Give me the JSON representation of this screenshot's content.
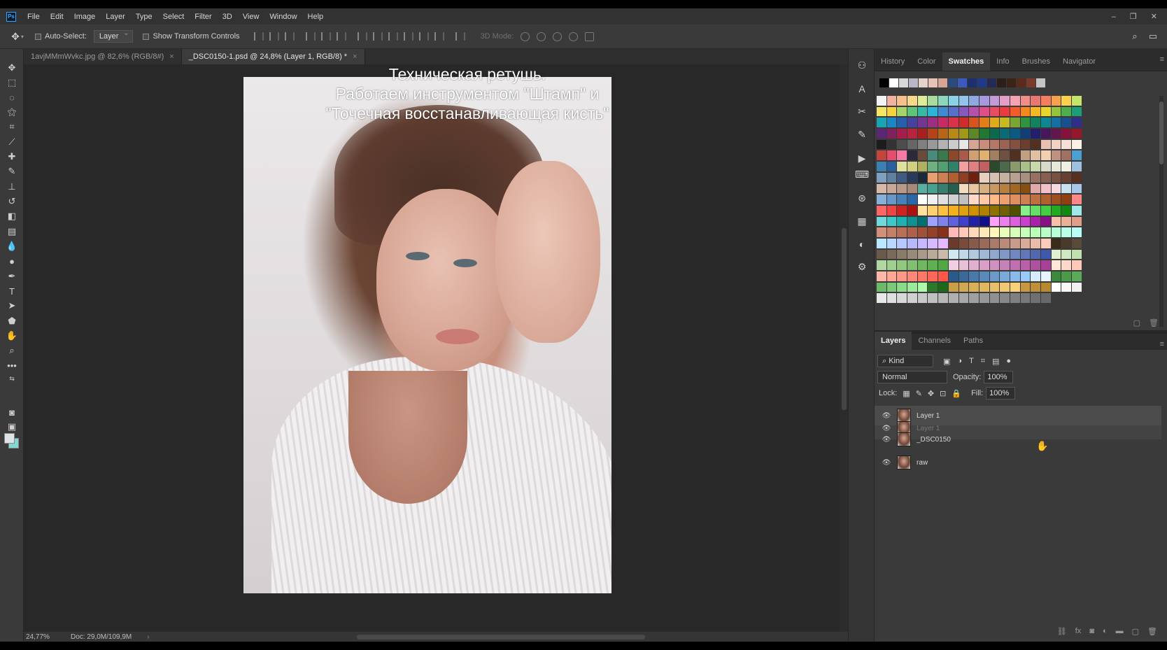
{
  "menubar": {
    "logo": "Ps",
    "items": [
      "File",
      "Edit",
      "Image",
      "Layer",
      "Type",
      "Select",
      "Filter",
      "3D",
      "View",
      "Window",
      "Help"
    ],
    "controls": [
      "–",
      "❐",
      "✕"
    ]
  },
  "options": {
    "auto_select_label": "Auto-Select:",
    "auto_select_value": "Layer",
    "transform_label": "Show Transform Controls",
    "mode3d_label": "3D Mode:"
  },
  "tabs": [
    {
      "label": "1avjMMmWvkc.jpg @ 82,6% (RGB/8#)",
      "close": "×"
    },
    {
      "label": "_DSC0150-1.psd @ 24,8% (Layer 1, RGB/8) *",
      "close": "×"
    }
  ],
  "canvas": {
    "overlay_lines": [
      "Техническая ретушь.",
      "Работаем инструментом \"Штамп\" и",
      "\"Точечная восстанавливающая кисть\""
    ]
  },
  "status": {
    "zoom": "24,77%",
    "doc": "Doc: 29,0M/109,9M",
    "arrow": "›"
  },
  "swatches_panel": {
    "tabs": [
      "History",
      "Color",
      "Swatches",
      "Info",
      "Brushes",
      "Navigator"
    ],
    "active_tab": "Swatches",
    "recent_colors": [
      "#000000",
      "#ffffff",
      "#d8d8d8",
      "#b7b7c8",
      "#e6d2cc",
      "#e7c3b5",
      "#d7a594",
      "#2c4a7a",
      "#3a5bbd",
      "#1e2f6f",
      "#1f3a8a",
      "#252a55",
      "#2a1f1a",
      "#3a2418",
      "#5a2a1a",
      "#7a3a2a",
      "#c4c4c4"
    ],
    "palette": [
      "#f3f3f3",
      "#f2b2a2",
      "#f6c08c",
      "#f9d88a",
      "#dcec98",
      "#a7dc9c",
      "#8ed7bf",
      "#8ad3e6",
      "#92c4ec",
      "#8fa9e2",
      "#a699de",
      "#c19ad9",
      "#e29ec7",
      "#f4a2b4",
      "#f08f88",
      "#ea7670",
      "#f37f5f",
      "#f7a04e",
      "#fbd14b",
      "#c6e46a",
      "#f4e562",
      "#f6d33e",
      "#a7d46a",
      "#5cc67b",
      "#37b9a5",
      "#2cb3d6",
      "#3e8ad3",
      "#5870c9",
      "#8a57bf",
      "#b551ac",
      "#de4f8a",
      "#eb4a63",
      "#eb3b3e",
      "#f25c2a",
      "#f68822",
      "#f7b826",
      "#e6d62e",
      "#94c43e",
      "#4baf4b",
      "#1c9e78",
      "#18a4b2",
      "#1c86c4",
      "#2560ad",
      "#4542a2",
      "#74368f",
      "#9c2f80",
      "#c72a65",
      "#d9324a",
      "#d12b2b",
      "#d9531f",
      "#e07f1a",
      "#e0a81c",
      "#c7ba20",
      "#78a533",
      "#2f933f",
      "#11845f",
      "#0f8793",
      "#156fa0",
      "#184f8f",
      "#2f2f87",
      "#5a2775",
      "#80205f",
      "#a41d4b",
      "#b7233a",
      "#a91e21",
      "#b4431a",
      "#b76615",
      "#b88916",
      "#a19818",
      "#5d8828",
      "#217830",
      "#096a4c",
      "#086b75",
      "#0c5a83",
      "#0f3f74",
      "#20206c",
      "#45185c",
      "#66154c",
      "#84123a",
      "#94182c",
      "#1c1c1c",
      "#333333",
      "#4d4d4d",
      "#666666",
      "#808080",
      "#999999",
      "#b3b3b3",
      "#cccccc",
      "#e6e6e6",
      "#d7a594",
      "#c88e7b",
      "#b57866",
      "#9d6352",
      "#84503f",
      "#6b3e2e",
      "#52301f",
      "#e8c1b2",
      "#f1d2c5",
      "#f6e0d6",
      "#fdf0e8",
      "#c4433b",
      "#e54d6a",
      "#f57aa5",
      "#2a2a3a",
      "#6a4a3a",
      "#4a8a7a",
      "#3a7a4a",
      "#8a4a2a",
      "#aa5a4a",
      "#d0a070",
      "#e0b070",
      "#a08060",
      "#705040",
      "#503020",
      "#c0a080",
      "#e0c0a0",
      "#f0d0b0",
      "#c09080",
      "#a07060",
      "#4aa0d0",
      "#3a80b0",
      "#2a60a0",
      "#e0e0a0",
      "#d0d080",
      "#b0b060",
      "#70b080",
      "#50a070",
      "#30806a",
      "#f0a0a0",
      "#e08080",
      "#c06060",
      "#2a4a2a",
      "#4a6a4a",
      "#8a9a6a",
      "#aac08a",
      "#c8d8aa",
      "#dadaca",
      "#e8e8d8",
      "#f0f0e0",
      "#a0c0e0",
      "#80a0c0",
      "#6080a0",
      "#405a80",
      "#2a3a5a",
      "#1a2a3a",
      "#e8a070",
      "#d08050",
      "#b06030",
      "#904020",
      "#702010",
      "#e8d0c0",
      "#d8c0b0",
      "#c8b0a0",
      "#b8a090",
      "#a89080",
      "#987060",
      "#886050",
      "#785040",
      "#684030",
      "#583020",
      "#d8b8a8",
      "#c8a898",
      "#b89888",
      "#a88878",
      "#5ab0a0",
      "#48a090",
      "#368070",
      "#246050",
      "#f2dcc0",
      "#e8c8a0",
      "#d8b080",
      "#c89860",
      "#b88040",
      "#a06820",
      "#885010",
      "#e0a8a8",
      "#f4c0c8",
      "#f8d8e0",
      "#c8e0f0",
      "#a8c8e8",
      "#88b0d8",
      "#6898c8",
      "#4880b8",
      "#2868a8",
      "#ffffff",
      "#f0f0f0",
      "#e0e0e0",
      "#d0d0d0",
      "#c0c0c0",
      "#ffd8c8",
      "#ffc8a8",
      "#ffb888",
      "#f0a070",
      "#e09060",
      "#d08050",
      "#c07040",
      "#b06030",
      "#a05020",
      "#904010",
      "#ff8888",
      "#ff6666",
      "#ee4444",
      "#cc2222",
      "#aa1111",
      "#ffe0a0",
      "#ffd070",
      "#ffc040",
      "#f0b020",
      "#e0a010",
      "#d09000",
      "#b08000",
      "#907000",
      "#706000",
      "#505000",
      "#88ee88",
      "#66dd66",
      "#44cc44",
      "#22aa22",
      "#118811",
      "#a0e8e8",
      "#70d8d8",
      "#40c8c8",
      "#20b0b0",
      "#109090",
      "#007070",
      "#a0a0ff",
      "#8080ee",
      "#6060dd",
      "#4040cc",
      "#2020aa",
      "#101088",
      "#ffa0ff",
      "#ee80ee",
      "#dd60dd",
      "#cc40cc",
      "#aa20aa",
      "#881088",
      "#f6c0a8",
      "#eab098",
      "#dea088",
      "#d29078",
      "#c68068",
      "#ba7058",
      "#ae6048",
      "#a25038",
      "#964028",
      "#8a3018",
      "#ffb8b8",
      "#ffc8b8",
      "#ffd8b8",
      "#ffe8b8",
      "#fff8b8",
      "#e8ffb8",
      "#d8ffb8",
      "#c8ffb8",
      "#b8ffb8",
      "#b8ffc8",
      "#b8ffd8",
      "#b8ffe8",
      "#b8fff8",
      "#b8e8ff",
      "#b8d8ff",
      "#b8c8ff",
      "#b8b8ff",
      "#c8b8ff",
      "#d8b8ff",
      "#e8b8ff",
      "#6a3a2a",
      "#7a4a3a",
      "#8a5a4a",
      "#9a6a5a",
      "#aa7a6a",
      "#ba8a7a",
      "#ca9a8a",
      "#daaa9a",
      "#eabaaa",
      "#facaba",
      "#3a2a1a",
      "#4a3a2a",
      "#5a4a3a",
      "#6a5a4a",
      "#7a6a5a",
      "#8a7a6a",
      "#9a8a7a",
      "#aa9a8a",
      "#baaa9a",
      "#cabaaa",
      "#d0e8f0",
      "#c0d8e8",
      "#b0c8e0",
      "#a0b8d8",
      "#90a8d0",
      "#8098c8",
      "#7088c0",
      "#6078b8",
      "#5068b0",
      "#4058a8",
      "#e0f0d0",
      "#d0e8c0",
      "#c0e0b0",
      "#b0d8a0",
      "#a0d090",
      "#90c880",
      "#80c070",
      "#70b860",
      "#60b050",
      "#50a840",
      "#f0d0e0",
      "#e8c0d8",
      "#e0b0d0",
      "#d8a0c8",
      "#d090c0",
      "#c880b8",
      "#c070b0",
      "#b860a8",
      "#b050a0",
      "#a84098",
      "#ffe8d8",
      "#ffd8c8",
      "#ffc8b8",
      "#ffb8a8",
      "#ffa898",
      "#ff9888",
      "#ff8878",
      "#ff7868",
      "#ff6858",
      "#ff5848",
      "#2a5a8a",
      "#3a6a9a",
      "#4a7aaa",
      "#5a8aba",
      "#6a9aca",
      "#7aaada",
      "#8abaea",
      "#9acafa",
      "#d8ecff",
      "#e8f4ff",
      "#3a8a3a",
      "#4a9a4a",
      "#5aaa5a",
      "#6aba6a",
      "#7aca7a",
      "#8ada8a",
      "#9aea9a",
      "#aafaaa",
      "#2a7a2a",
      "#1a6a1a",
      "#c8a048",
      "#d0a850",
      "#d8b058",
      "#e0b860",
      "#e8c068",
      "#f0c870",
      "#f8d078",
      "#c89840",
      "#c09038",
      "#b88830",
      "#ffffff",
      "#f8f8f8",
      "#f0f0f0",
      "#e8e8e8",
      "#e0e0e0",
      "#d8d8d8",
      "#d0d0d0",
      "#c8c8c8",
      "#c0c0c0",
      "#b8b8b8",
      "#b0b0b0",
      "#a8a8a8",
      "#a0a0a0",
      "#989898",
      "#909090",
      "#888888",
      "#808080",
      "#787878",
      "#707070",
      "#686868"
    ]
  },
  "layers_panel": {
    "tabs": [
      "Layers",
      "Channels",
      "Paths"
    ],
    "active_tab": "Layers",
    "kind_label": "⌕ Kind",
    "blend_mode": "Normal",
    "opacity_label": "Opacity:",
    "opacity_value": "100%",
    "lock_label": "Lock:",
    "fill_label": "Fill:",
    "fill_value": "100%",
    "layers": [
      {
        "name": "Layer 1",
        "state": "selected"
      },
      {
        "name": "Layer 1",
        "state": "ghost"
      },
      {
        "name": "_DSC0150",
        "state": "normal"
      },
      {
        "name": "raw",
        "state": "normal"
      }
    ]
  }
}
